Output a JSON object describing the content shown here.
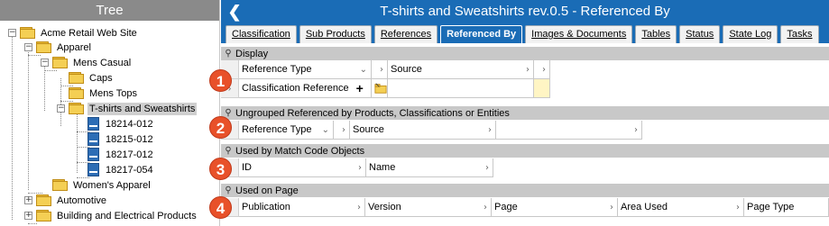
{
  "tree": {
    "header": "Tree",
    "nodes": [
      {
        "label": "Acme Retail Web Site",
        "expander": "−",
        "kind": "folder"
      },
      {
        "label": "Apparel",
        "expander": "−",
        "kind": "folder"
      },
      {
        "label": "Mens Casual",
        "expander": "−",
        "kind": "folder"
      },
      {
        "label": "Caps",
        "expander": "",
        "kind": "folder"
      },
      {
        "label": "Mens Tops",
        "expander": "",
        "kind": "folder"
      },
      {
        "label": "T-shirts and Sweatshirts",
        "expander": "−",
        "kind": "folder"
      },
      {
        "label": "18214-012",
        "expander": "",
        "kind": "product"
      },
      {
        "label": "18215-012",
        "expander": "",
        "kind": "product"
      },
      {
        "label": "18217-012",
        "expander": "",
        "kind": "product"
      },
      {
        "label": "18217-054",
        "expander": "",
        "kind": "product"
      },
      {
        "label": "Women's Apparel",
        "expander": "",
        "kind": "folder"
      },
      {
        "label": "Automotive",
        "expander": "+",
        "kind": "folder"
      },
      {
        "label": "Building and Electrical Products",
        "expander": "+",
        "kind": "folder"
      }
    ]
  },
  "title": {
    "back": "❮",
    "text": "T-shirts and Sweatshirts rev.0.5 - Referenced By"
  },
  "tabs": [
    "Classification",
    "Sub Products",
    "References",
    "Referenced By",
    "Images & Documents",
    "Tables",
    "Status",
    "State Log",
    "Tasks"
  ],
  "sections": {
    "display": {
      "pin": "⚲",
      "title": "Display",
      "col1": "Reference Type",
      "col2": "Source",
      "row_value": "Classification Reference",
      "row_plus": "+",
      "badge": "1"
    },
    "ungrouped": {
      "pin": "⚲",
      "title": "Ungrouped Referenced by Products, Classifications or Entities",
      "col1": "Reference Type",
      "col2": "Source",
      "badge": "2"
    },
    "match_code": {
      "pin": "⚲",
      "title": "Used by Match Code Objects",
      "col1": "ID",
      "col2": "Name",
      "badge": "3"
    },
    "used_on_page": {
      "pin": "⚲",
      "title": "Used on Page",
      "col1": "Publication",
      "col2": "Version",
      "col3": "Page",
      "col4": "Area Used",
      "col5": "Page Type",
      "badge": "4"
    }
  },
  "glyphs": {
    "chevron_right": "›",
    "chevron_down": "⌄"
  },
  "colors": {
    "title_blue": "#1a6cb6",
    "tree_header": "#8a8a8a",
    "badge_orange": "#e8512a",
    "section_gray": "#c8c8c8"
  }
}
